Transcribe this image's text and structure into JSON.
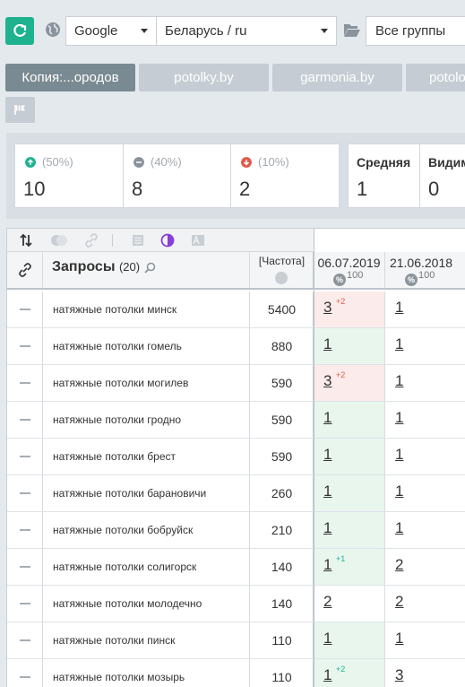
{
  "toolbar": {
    "engine": "Google",
    "region": "Беларусь / ru",
    "group": "Все группы"
  },
  "tabs": [
    {
      "label": "Копия:...ородов",
      "active": true
    },
    {
      "label": "potolky.by",
      "active": false
    },
    {
      "label": "garmonia.by",
      "active": false
    },
    {
      "label": "potolo",
      "active": false
    }
  ],
  "stats": {
    "up": {
      "pct": "(50%)",
      "value": "10"
    },
    "same": {
      "pct": "(40%)",
      "value": "8"
    },
    "down": {
      "pct": "(10%)",
      "value": "2"
    },
    "avg": {
      "label": "Средняя",
      "value": "1"
    },
    "visible": {
      "label": "Видим",
      "value": "0"
    }
  },
  "colors": {
    "accent": "#1eb28f",
    "up": "#1eb28f",
    "down": "#e05a47"
  },
  "table": {
    "title": "Запросы",
    "count": "(20)",
    "freq_label": "[Частота]",
    "dates": [
      "06.07.2019",
      "21.06.2018"
    ],
    "hundred": "100",
    "pct_symbol": "%",
    "rows": [
      {
        "query": "натяжные потолки минск",
        "freq": "5400",
        "p1": "3",
        "d1": "+2",
        "p2": "1",
        "bg": "red"
      },
      {
        "query": "натяжные потолки гомель",
        "freq": "880",
        "p1": "1",
        "d1": "",
        "p2": "1",
        "bg": "green"
      },
      {
        "query": "натяжные потолки могилев",
        "freq": "590",
        "p1": "3",
        "d1": "+2",
        "p2": "1",
        "bg": "red"
      },
      {
        "query": "натяжные потолки гродно",
        "freq": "590",
        "p1": "1",
        "d1": "",
        "p2": "1",
        "bg": "green"
      },
      {
        "query": "натяжные потолки брест",
        "freq": "590",
        "p1": "1",
        "d1": "",
        "p2": "1",
        "bg": "green"
      },
      {
        "query": "натяжные потолки барановичи",
        "freq": "260",
        "p1": "1",
        "d1": "",
        "p2": "1",
        "bg": "green"
      },
      {
        "query": "натяжные потолки бобруйск",
        "freq": "210",
        "p1": "1",
        "d1": "",
        "p2": "1",
        "bg": "green"
      },
      {
        "query": "натяжные потолки солигорск",
        "freq": "140",
        "p1": "1",
        "d1": "+1",
        "p2": "2",
        "bg": "green"
      },
      {
        "query": "натяжные потолки молодечно",
        "freq": "140",
        "p1": "2",
        "d1": "",
        "p2": "2",
        "bg": "none"
      },
      {
        "query": "натяжные потолки пинск",
        "freq": "110",
        "p1": "1",
        "d1": "",
        "p2": "1",
        "bg": "green"
      },
      {
        "query": "натяжные потолки мозырь",
        "freq": "110",
        "p1": "1",
        "d1": "+2",
        "p2": "3",
        "bg": "green"
      }
    ]
  }
}
